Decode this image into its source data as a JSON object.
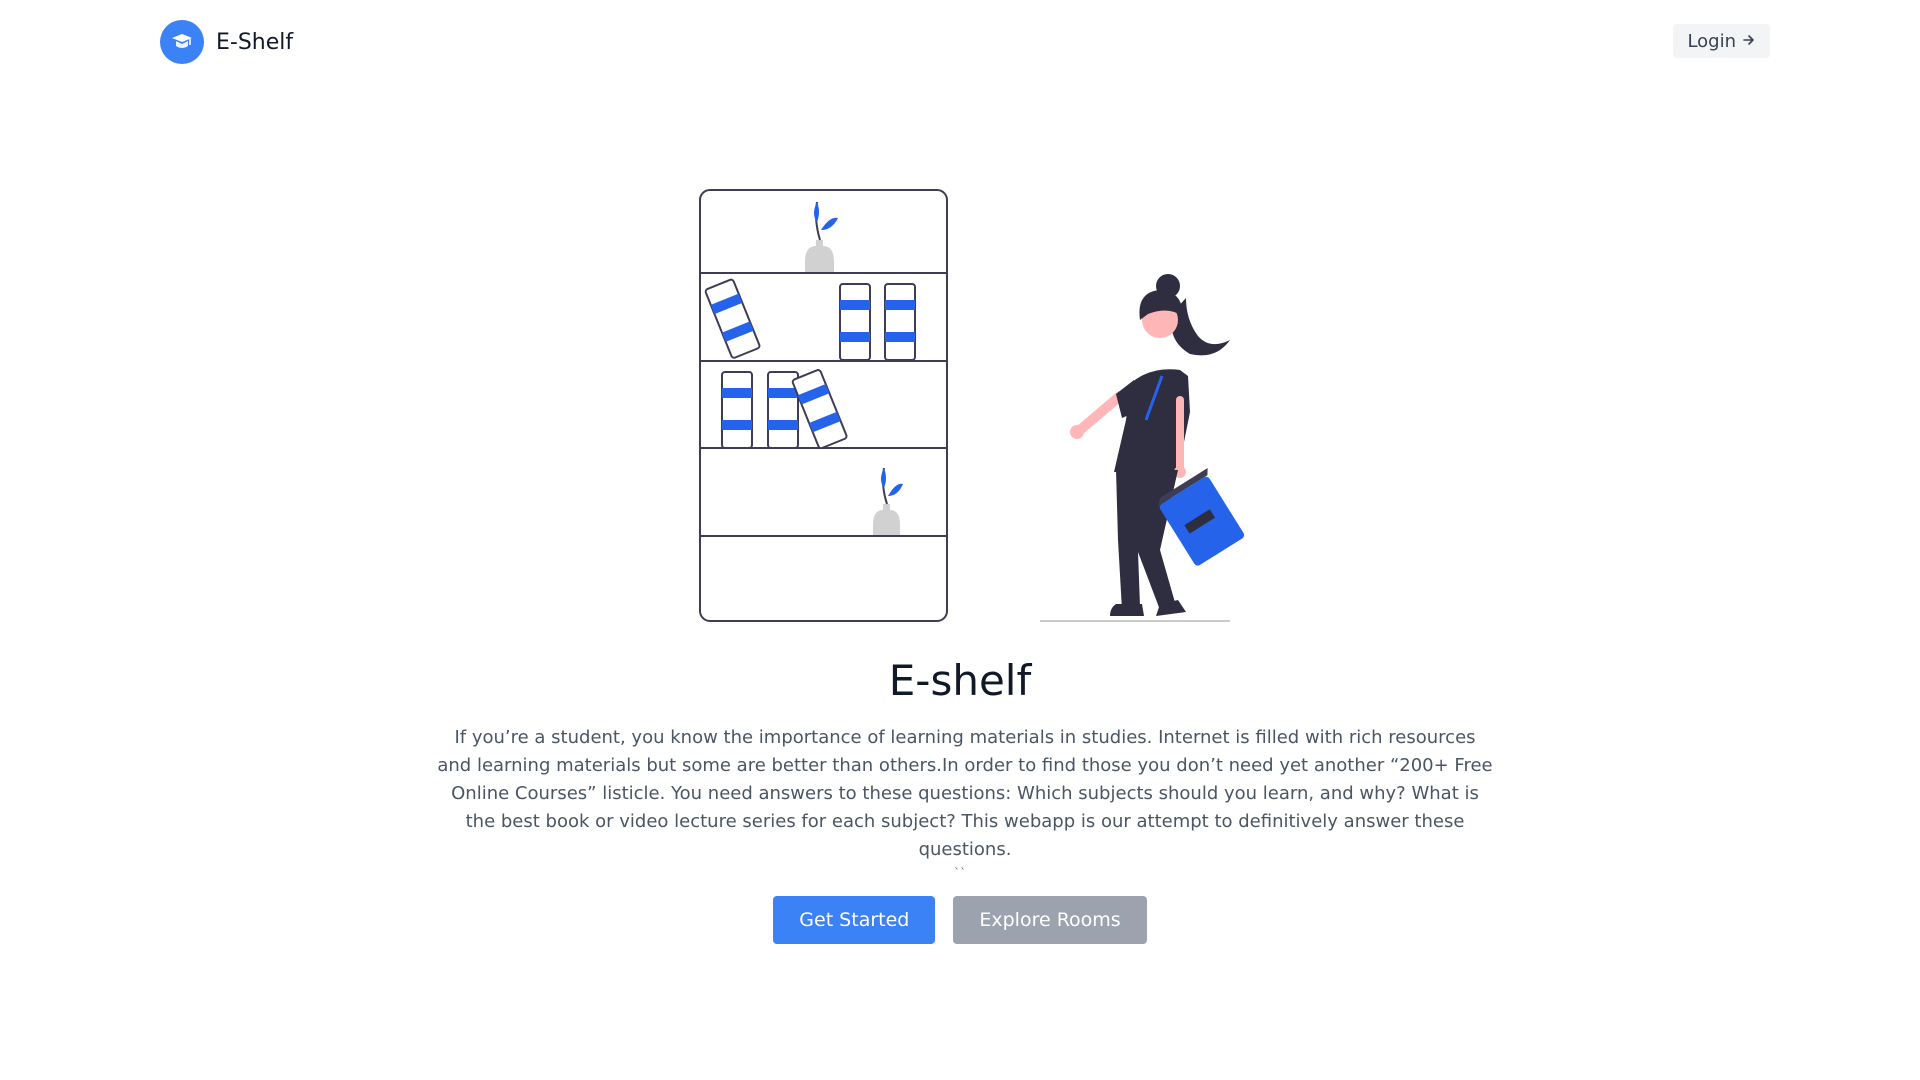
{
  "header": {
    "brand_name": "E-Shelf",
    "login_label": "Login",
    "logo_icon": "graduation-cap-icon",
    "login_icon": "arrow-right-icon"
  },
  "hero": {
    "title": "E-shelf",
    "description": "If you’re a student, you know the importance of learning materials in studies. Internet is filled with rich resources and learning materials but some are better than others.In order to find those you don’t need yet another “200+ Free Online Courses” listicle. You need answers to these questions: Which subjects should you learn, and why? What is the best book or video lecture series for each subject? This webapp is our attempt to definitively answer these questions.",
    "tick": "``",
    "primary_button": "Get Started",
    "secondary_button": "Explore Rooms",
    "illustration": "woman-with-bookshelf-illustration"
  },
  "colors": {
    "accent": "#3b82f6",
    "secondary_button": "#9ca3af",
    "login_bg": "#f3f4f6",
    "dark_figure": "#2f2e41",
    "skin": "#ffb6b6"
  }
}
